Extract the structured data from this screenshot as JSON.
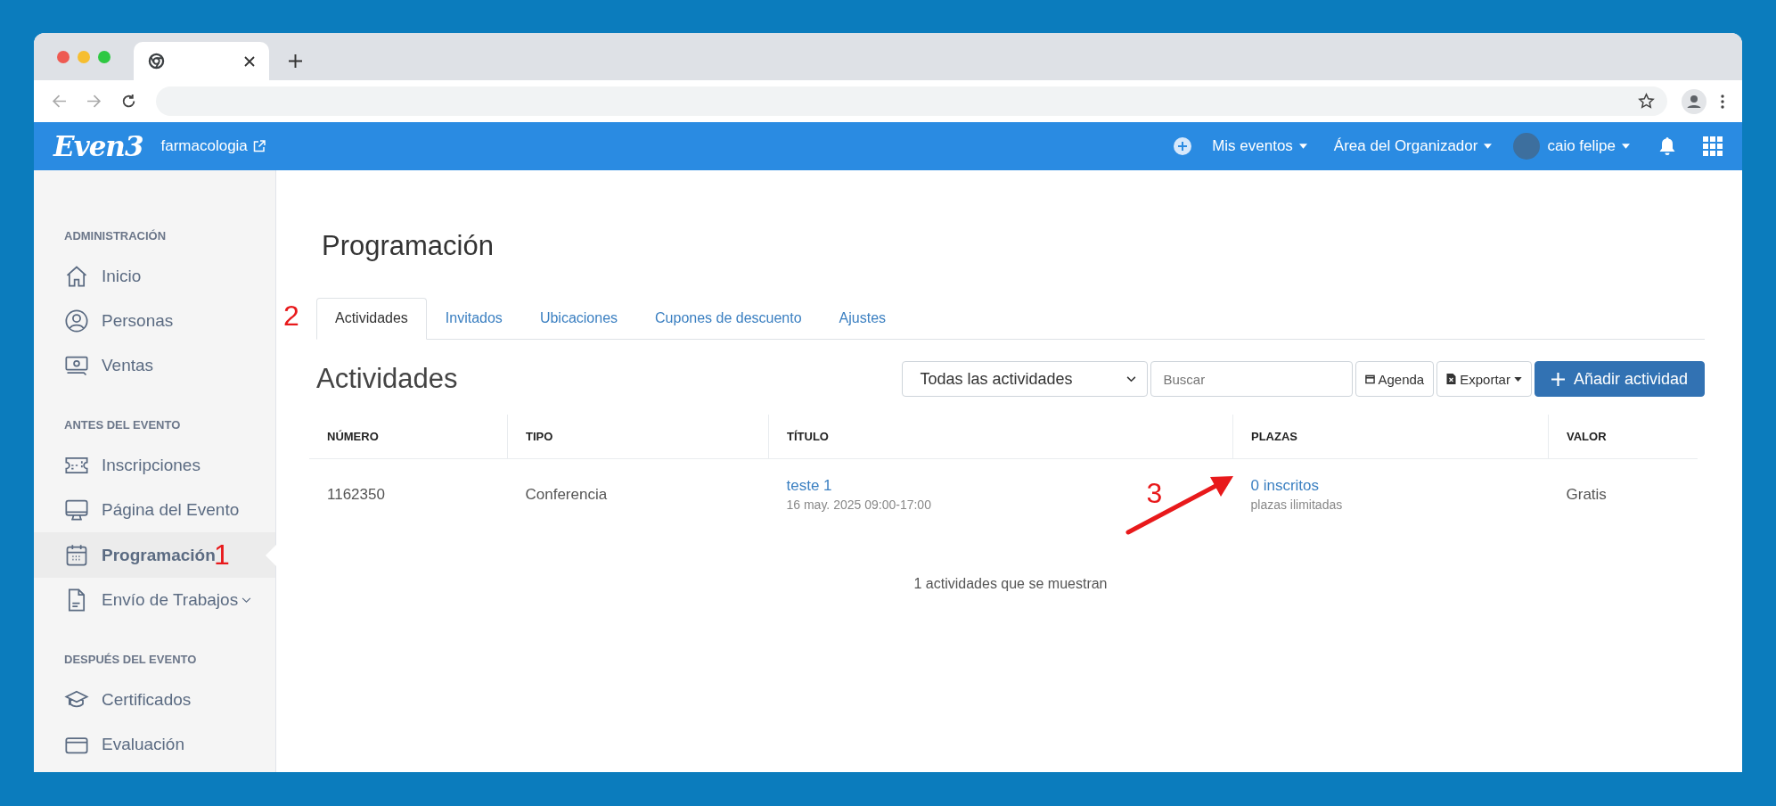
{
  "header": {
    "logo": "Even3",
    "event_link": "farmacologia",
    "nav": [
      {
        "label": "Mis eventos",
        "kind": "menu"
      },
      {
        "label": "Área del Organizador",
        "kind": "menu"
      },
      {
        "label": "caio felipe",
        "kind": "user"
      }
    ]
  },
  "sidebar": {
    "sections": [
      {
        "title": "ADMINISTRACIÓN",
        "items": [
          {
            "label": "Inicio",
            "selected": false
          },
          {
            "label": "Personas",
            "selected": false
          },
          {
            "label": "Ventas",
            "selected": false
          }
        ]
      },
      {
        "title": "ANTES DEL EVENTO",
        "items": [
          {
            "label": "Inscripciones",
            "selected": false
          },
          {
            "label": "Página del Evento",
            "selected": false
          },
          {
            "label": "Programación",
            "selected": true,
            "annotation": "1"
          },
          {
            "label": "Envío de Trabajos",
            "selected": false,
            "expanded": false
          }
        ]
      },
      {
        "title": "DESPUÉS DEL EVENTO",
        "items": [
          {
            "label": "Certificados",
            "selected": false
          },
          {
            "label": "Evaluación",
            "selected": false
          }
        ]
      }
    ]
  },
  "page": {
    "title": "Programación",
    "tabs_annotation": "2",
    "tabs": [
      {
        "label": "Actividades",
        "selected": true
      },
      {
        "label": "Invitados",
        "selected": false
      },
      {
        "label": "Ubicaciones",
        "selected": false
      },
      {
        "label": "Cupones de descuento",
        "selected": false
      },
      {
        "label": "Ajustes",
        "selected": false
      }
    ],
    "section_title": "Actividades",
    "filter": {
      "value": "Todas las actividades"
    },
    "search": {
      "placeholder": "Buscar"
    },
    "buttons": [
      {
        "label": "Agenda",
        "kind": "agenda"
      },
      {
        "label": "Exportar",
        "kind": "export"
      },
      {
        "label": "Añadir actividad",
        "kind": "primary"
      }
    ],
    "table": {
      "columns": [
        "NÚMERO",
        "TIPO",
        "TÍTULO",
        "PLAZAS",
        "VALOR"
      ],
      "rows": [
        {
          "number": "1162350",
          "type": "Conferencia",
          "title": "teste 1",
          "date": "16 may. 2025 09:00-17:00",
          "enrolled": "0 inscritos",
          "places": "plazas ilimitadas",
          "value": "Gratis",
          "annotation": "3"
        }
      ]
    },
    "footer": "1 actividades que se muestran"
  }
}
